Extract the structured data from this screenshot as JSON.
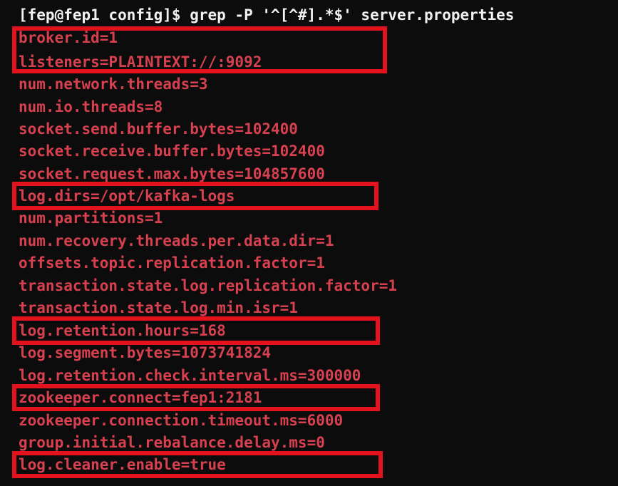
{
  "terminal": {
    "command": "[fep@fep1 config]$ grep -P '^[^#].*$' server.properties",
    "lines": [
      "broker.id=1",
      "listeners=PLAINTEXT://:9092",
      "num.network.threads=3",
      "num.io.threads=8",
      "socket.send.buffer.bytes=102400",
      "socket.receive.buffer.bytes=102400",
      "socket.request.max.bytes=104857600",
      "log.dirs=/opt/kafka-logs",
      "num.partitions=1",
      "num.recovery.threads.per.data.dir=1",
      "offsets.topic.replication.factor=1",
      "transaction.state.log.replication.factor=1",
      "transaction.state.log.min.isr=1",
      "log.retention.hours=168",
      "log.segment.bytes=1073741824",
      "log.retention.check.interval.ms=300000",
      "zookeeper.connect=fep1:2181",
      "zookeeper.connection.timeout.ms=6000",
      "group.initial.rebalance.delay.ms=0",
      "log.cleaner.enable=true"
    ]
  },
  "colors": {
    "background": "#0c0c0c",
    "prompt_text": "#f2f2f2",
    "config_text": "#d7414f",
    "highlight": "#e3121d"
  }
}
